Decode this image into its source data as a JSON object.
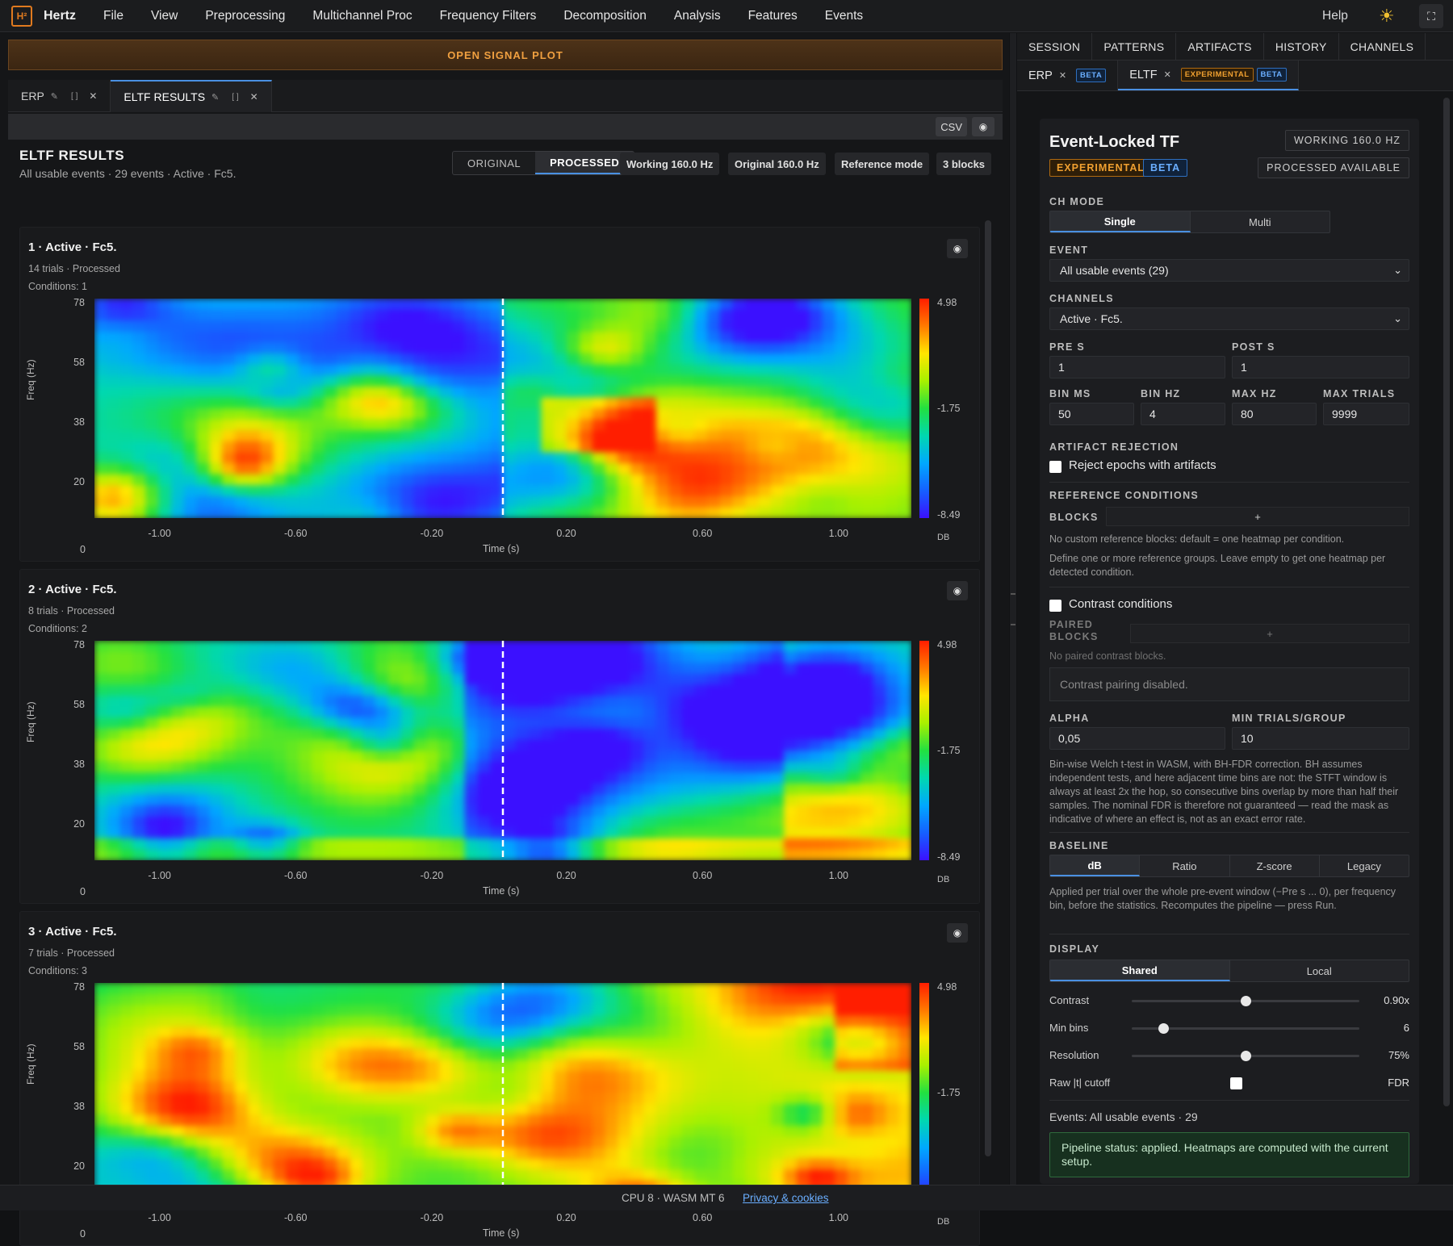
{
  "app": {
    "logo_text": "H²",
    "name": "Hertz"
  },
  "menu": [
    "File",
    "View",
    "Preprocessing",
    "Multichannel Proc",
    "Frequency Filters",
    "Decomposition",
    "Analysis",
    "Features",
    "Events"
  ],
  "menu_right": {
    "help": "Help",
    "theme_icon": "sun-icon",
    "fullscreen_icon": "fullscreen-icon"
  },
  "open_plot_label": "OPEN SIGNAL PLOT",
  "doc_tabs": [
    {
      "label": "ERP",
      "active": false
    },
    {
      "label": "ELTF RESULTS",
      "active": true
    }
  ],
  "toolbar": {
    "csv": "CSV",
    "camera_icon": "camera-icon"
  },
  "results": {
    "title": "ELTF RESULTS",
    "subtitle": "All usable events · 29 events · Active · Fc5.",
    "view_toggle": {
      "options": [
        "ORIGINAL",
        "PROCESSED"
      ],
      "selected": "PROCESSED"
    },
    "chips": [
      "Working 160.0 Hz",
      "Original 160.0 Hz",
      "Reference mode",
      "3 blocks"
    ]
  },
  "panels": [
    {
      "title": "1 · Active · Fc5.",
      "trials": "14 trials · Processed",
      "conditions": "Conditions: 1"
    },
    {
      "title": "2 · Active · Fc5.",
      "trials": "8 trials · Processed",
      "conditions": "Conditions: 2"
    },
    {
      "title": "3 · Active · Fc5.",
      "trials": "7 trials · Processed",
      "conditions": "Conditions: 3"
    }
  ],
  "heatmap_axes": {
    "y_ticks": [
      "78",
      "58",
      "38",
      "20"
    ],
    "zero_label": "0",
    "x_ticks": [
      "-1.00",
      "-0.60",
      "-0.20",
      "0.20",
      "0.60",
      "1.00"
    ],
    "xlabel": "Time (s)",
    "ylabel": "Freq (Hz)",
    "colorbar_ticks": [
      "4.98",
      "-1.75",
      "-8.49"
    ],
    "colorbar_unit": "DB",
    "xlim": [
      -1.2,
      1.2
    ],
    "event_marker_at": 0
  },
  "right_tabs": [
    "SESSION",
    "PATTERNS",
    "ARTIFACTS",
    "HISTORY",
    "CHANNELS"
  ],
  "right_subtabs": [
    {
      "label": "ERP",
      "tags": [
        "BETA"
      ]
    },
    {
      "label": "ELTF",
      "tags": [
        "EXPERIMENTAL",
        "BETA"
      ],
      "active": true
    }
  ],
  "eltf": {
    "title": "Event-Locked TF",
    "badge_exp": "EXPERIMENTAL",
    "badge_beta": "BETA",
    "working_chip": "WORKING 160.0 HZ",
    "processed_chip": "PROCESSED AVAILABLE",
    "ch_mode": {
      "label": "CH MODE",
      "options": [
        "Single",
        "Multi"
      ],
      "selected": "Single"
    },
    "event": {
      "label": "EVENT",
      "value": "All usable events (29)"
    },
    "channels": {
      "label": "CHANNELS",
      "value": "Active · Fc5."
    },
    "pre_s": {
      "label": "PRE S",
      "value": "1"
    },
    "post_s": {
      "label": "POST S",
      "value": "1"
    },
    "bin_ms": {
      "label": "BIN MS",
      "value": "50"
    },
    "bin_hz": {
      "label": "BIN HZ",
      "value": "4"
    },
    "max_hz": {
      "label": "MAX HZ",
      "value": "80"
    },
    "max_trials": {
      "label": "MAX TRIALS",
      "value": "9999"
    },
    "artifact": {
      "label": "ARTIFACT REJECTION",
      "checkbox": "Reject epochs with artifacts"
    },
    "refcond": {
      "label": "REFERENCE CONDITIONS",
      "blocks_label": "BLOCKS",
      "add": "+",
      "help1": "No custom reference blocks: default = one heatmap per condition.",
      "help2": "Define one or more reference groups. Leave empty to get one heatmap per detected condition."
    },
    "contrast": {
      "checkbox": "Contrast conditions",
      "paired_label": "PAIRED BLOCKS",
      "add": "+",
      "none": "No paired contrast blocks.",
      "disabled": "Contrast pairing disabled."
    },
    "alpha": {
      "label": "ALPHA",
      "value": "0,05"
    },
    "min_trials": {
      "label": "MIN TRIALS/GROUP",
      "value": "10"
    },
    "stats_help": "Bin-wise Welch t-test in WASM, with BH-FDR correction. BH assumes independent tests, and here adjacent time bins are not: the STFT window is always at least 2x the hop, so consecutive bins overlap by more than half their samples. The nominal FDR is therefore not guaranteed — read the mask as indicative of where an effect is, not as an exact error rate.",
    "baseline": {
      "label": "BASELINE",
      "options": [
        "dB",
        "Ratio",
        "Z-score",
        "Legacy"
      ],
      "selected": "dB",
      "help": "Applied per trial over the whole pre-event window (−Pre s ... 0), per frequency bin, before the statistics. Recomputes the pipeline — press Run."
    },
    "display": {
      "label": "DISPLAY",
      "options": [
        "Shared",
        "Local"
      ],
      "selected": "Shared",
      "contrast": {
        "label": "Contrast",
        "value": "0.90x",
        "fraction": 0.5
      },
      "min_bins": {
        "label": "Min bins",
        "value": "6",
        "fraction": 0.14
      },
      "resolution": {
        "label": "Resolution",
        "value": "75%",
        "fraction": 0.5
      },
      "raw_cutoff": {
        "label": "Raw |t| cutoff",
        "value": "FDR"
      }
    },
    "events_line": "Events: All usable events · 29",
    "status": "Pipeline status: applied. Heatmaps are computed with the current setup."
  },
  "footer": {
    "cpu": "CPU 8 · WASM MT 6",
    "privacy": "Privacy & cookies"
  }
}
